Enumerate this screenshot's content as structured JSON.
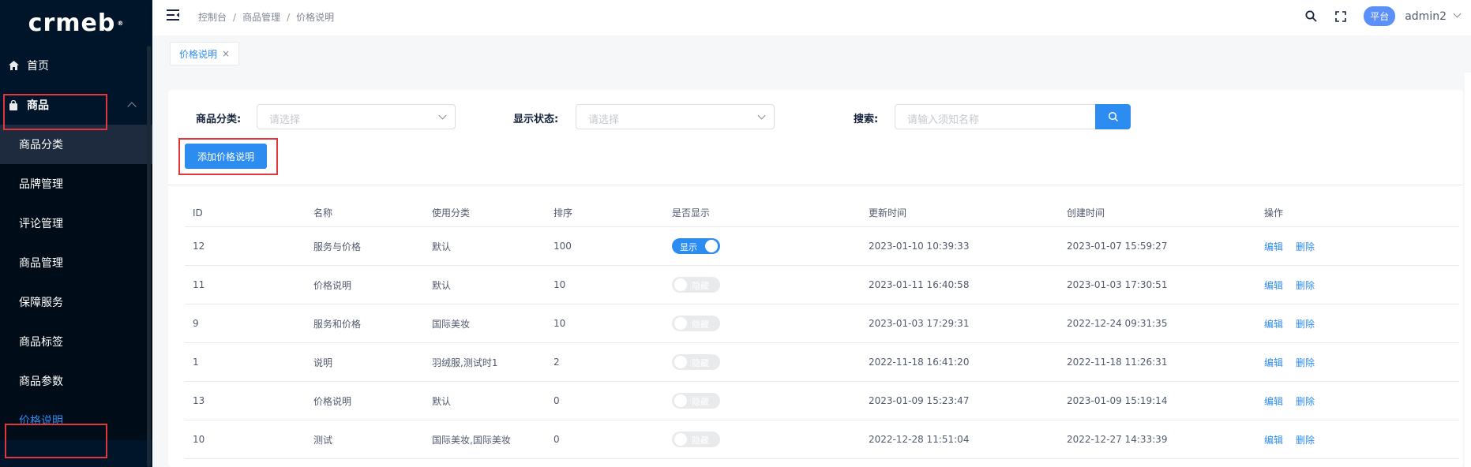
{
  "sidebar": {
    "logo": "crmeb",
    "logo_mark": "®",
    "items": [
      {
        "label": "首页",
        "icon": "home-icon"
      },
      {
        "label": "商品",
        "icon": "bag-icon"
      }
    ],
    "sub_items": [
      {
        "label": "商品分类"
      },
      {
        "label": "品牌管理"
      },
      {
        "label": "评论管理"
      },
      {
        "label": "商品管理"
      },
      {
        "label": "保障服务"
      },
      {
        "label": "商品标签"
      },
      {
        "label": "商品参数"
      },
      {
        "label": "价格说明"
      }
    ]
  },
  "header": {
    "breadcrumb": [
      "控制台",
      "商品管理",
      "价格说明"
    ],
    "breadcrumb_sep": "/",
    "platform": "平台",
    "user": "admin2"
  },
  "tabs": [
    {
      "label": "价格说明",
      "close": "×"
    }
  ],
  "filters": {
    "category_label": "商品分类:",
    "category_placeholder": "请选择",
    "status_label": "显示状态:",
    "status_placeholder": "请选择",
    "search_label": "搜索:",
    "search_placeholder": "请输入须知名称"
  },
  "add_button": "添加价格说明",
  "table": {
    "columns": [
      "ID",
      "名称",
      "使用分类",
      "排序",
      "是否显示",
      "更新时间",
      "创建时间",
      "操作"
    ],
    "rows": [
      {
        "id": "12",
        "name": "服务与价格",
        "category": "默认",
        "sort": "100",
        "show": true,
        "updated": "2023-01-10 10:39:33",
        "created": "2023-01-07 15:59:27"
      },
      {
        "id": "11",
        "name": "价格说明",
        "category": "默认",
        "sort": "10",
        "show": false,
        "updated": "2023-01-11 16:40:58",
        "created": "2023-01-03 17:30:51"
      },
      {
        "id": "9",
        "name": "服务和价格",
        "category": "国际美妆",
        "sort": "10",
        "show": false,
        "updated": "2023-01-03 17:29:31",
        "created": "2022-12-24 09:31:35"
      },
      {
        "id": "1",
        "name": "说明",
        "category": "羽绒服,测试时1",
        "sort": "2",
        "show": false,
        "updated": "2022-11-18 16:41:20",
        "created": "2022-11-18 11:26:31"
      },
      {
        "id": "13",
        "name": "价格说明",
        "category": "默认",
        "sort": "0",
        "show": false,
        "updated": "2023-01-09 15:23:47",
        "created": "2023-01-09 15:19:14"
      },
      {
        "id": "10",
        "name": "测试",
        "category": "国际美妆,国际美妆",
        "sort": "0",
        "show": false,
        "updated": "2022-12-28 11:51:04",
        "created": "2022-12-27 14:33:39"
      }
    ],
    "switch_on": "显示",
    "switch_off": "隐藏",
    "edit": "编辑",
    "delete": "删除"
  }
}
